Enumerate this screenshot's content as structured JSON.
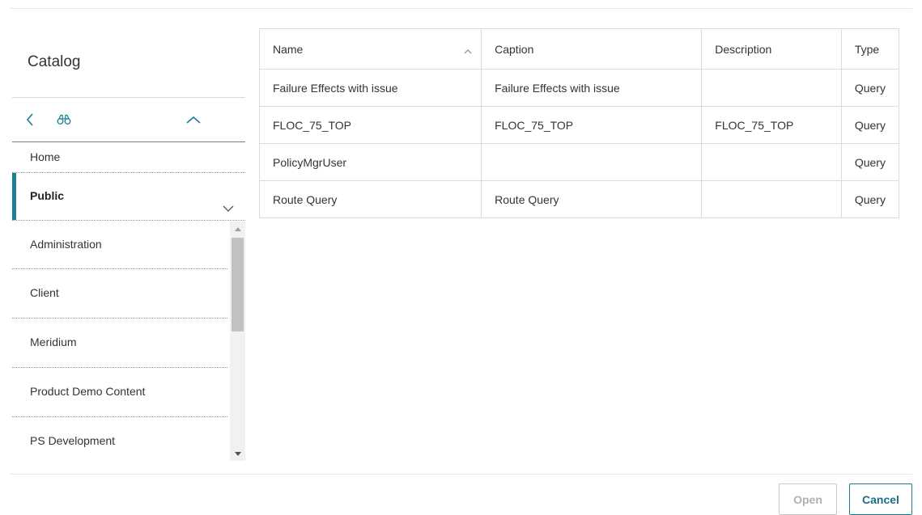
{
  "catalog": {
    "title": "Catalog",
    "home_label": "Home",
    "public_label": "Public",
    "sub_items": [
      {
        "label": "Administration"
      },
      {
        "label": "Client"
      },
      {
        "label": "Meridium"
      },
      {
        "label": "Product Demo Content"
      },
      {
        "label": "PS Development"
      }
    ]
  },
  "table": {
    "columns": [
      "Name",
      "Caption",
      "Description",
      "Type"
    ],
    "sorted_column": "Name",
    "rows": [
      {
        "name": "Failure Effects with issue",
        "caption": "Failure Effects with issue",
        "description": "",
        "type": "Query"
      },
      {
        "name": "FLOC_75_TOP",
        "caption": "FLOC_75_TOP",
        "description": "FLOC_75_TOP",
        "type": "Query"
      },
      {
        "name": "PolicyMgrUser",
        "caption": "",
        "description": "",
        "type": "Query"
      },
      {
        "name": "Route Query",
        "caption": "Route Query",
        "description": "",
        "type": "Query"
      }
    ]
  },
  "footer": {
    "open_label": "Open",
    "cancel_label": "Cancel"
  },
  "colors": {
    "accent": "#1b7f93",
    "disabled_text": "#b0b0b0"
  },
  "icons": {
    "back": "chevron-left-icon",
    "search": "binoculars-icon",
    "collapse": "chevron-up-icon",
    "expand": "chevron-down-icon",
    "sort": "sort-ascending-icon"
  }
}
